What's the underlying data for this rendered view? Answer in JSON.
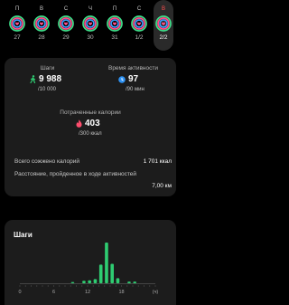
{
  "colors": {
    "steps": "#2ecc71",
    "active": "#2e93f5",
    "calories": "#ff4d6d",
    "ring_green": "#3ee08a",
    "ring_pink": "#ff4f8b",
    "ring_blue": "#3aa0ff",
    "weekend": "#ff4d4d"
  },
  "week": {
    "days": [
      {
        "letter": "П",
        "num": "27",
        "weekend": false,
        "selected": false
      },
      {
        "letter": "В",
        "num": "28",
        "weekend": false,
        "selected": false
      },
      {
        "letter": "С",
        "num": "29",
        "weekend": false,
        "selected": false
      },
      {
        "letter": "Ч",
        "num": "30",
        "weekend": false,
        "selected": false
      },
      {
        "letter": "П",
        "num": "31",
        "weekend": false,
        "selected": false
      },
      {
        "letter": "С",
        "num": "1/2",
        "weekend": false,
        "selected": false
      },
      {
        "letter": "В",
        "num": "2/2",
        "weekend": true,
        "selected": true
      }
    ]
  },
  "metrics": {
    "steps": {
      "label": "Шаги",
      "value": "9 988",
      "goal": "/10 000",
      "icon": "walking-figure-icon"
    },
    "active_time": {
      "label": "Время активности",
      "value": "97",
      "goal": "/90 мин",
      "icon": "clock-icon"
    },
    "calories": {
      "label": "Потраченные калории",
      "value": "403",
      "goal": "/300 ккал",
      "icon": "flame-icon"
    }
  },
  "summary": {
    "total_calories_label": "Всего сожжено калорий",
    "total_calories_value": "1 701 ккал",
    "distance_label": "Расстояние, пройденное в ходе активностей",
    "distance_value": "7,00 км"
  },
  "steps_chart": {
    "title": "Шаги"
  },
  "chart_data": {
    "type": "bar",
    "title": "Шаги",
    "xlabel": "",
    "ylabel": "",
    "x_ticks": [
      "0",
      "6",
      "12",
      "18",
      "(ч)"
    ],
    "xlim": [
      0,
      24
    ],
    "grid": false,
    "series": [
      {
        "hours": [
          9,
          11,
          12,
          13,
          14,
          15,
          16,
          17,
          19,
          20
        ],
        "values": [
          150,
          300,
          350,
          500,
          2200,
          4800,
          2300,
          600,
          200,
          200
        ]
      }
    ]
  }
}
